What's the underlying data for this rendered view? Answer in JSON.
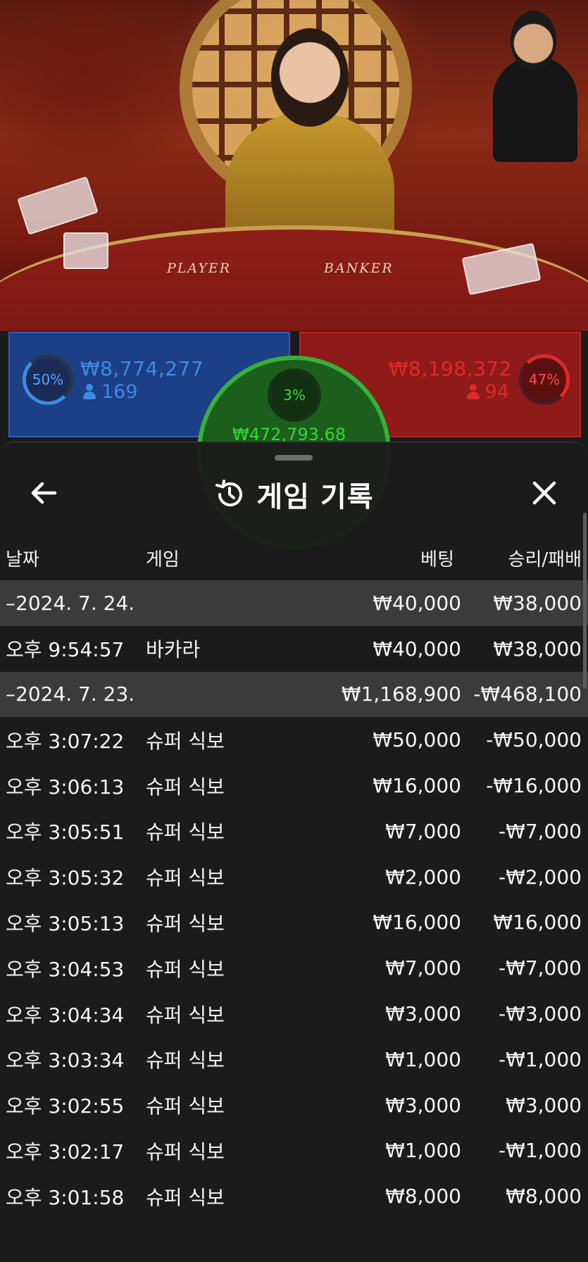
{
  "table": {
    "player_label": "PLAYER",
    "banker_label": "BANKER"
  },
  "bets": {
    "player": {
      "percent": "50%",
      "amount": "₩8,774,277",
      "count": "169",
      "color": "#3a8ce0"
    },
    "tie": {
      "percent": "3%",
      "amount": "₩472,793.68",
      "color": "#36d636"
    },
    "banker": {
      "percent": "47%",
      "amount": "₩8,198,372",
      "count": "94",
      "color": "#e02828"
    }
  },
  "sheet": {
    "title": "게임 기록",
    "back_icon": "arrow-left-icon",
    "history_icon": "history-icon",
    "close_icon": "close-icon",
    "columns": {
      "date": "날짜",
      "game": "게임",
      "bet": "베팅",
      "result": "승리/패배"
    },
    "rows": [
      {
        "type": "date",
        "date": "–2024. 7. 24.",
        "game": "",
        "bet": "₩40,000",
        "result": "₩38,000"
      },
      {
        "type": "entry",
        "date": "오후 9:54:57",
        "game": "바카라",
        "bet": "₩40,000",
        "result": "₩38,000"
      },
      {
        "type": "date",
        "date": "–2024. 7. 23.",
        "game": "",
        "bet": "₩1,168,900",
        "result": "-₩468,100"
      },
      {
        "type": "entry",
        "date": "오후 3:07:22",
        "game": "슈퍼 식보",
        "bet": "₩50,000",
        "result": "-₩50,000"
      },
      {
        "type": "entry",
        "date": "오후 3:06:13",
        "game": "슈퍼 식보",
        "bet": "₩16,000",
        "result": "-₩16,000"
      },
      {
        "type": "entry",
        "date": "오후 3:05:51",
        "game": "슈퍼 식보",
        "bet": "₩7,000",
        "result": "-₩7,000"
      },
      {
        "type": "entry",
        "date": "오후 3:05:32",
        "game": "슈퍼 식보",
        "bet": "₩2,000",
        "result": "-₩2,000"
      },
      {
        "type": "entry",
        "date": "오후 3:05:13",
        "game": "슈퍼 식보",
        "bet": "₩16,000",
        "result": "₩16,000"
      },
      {
        "type": "entry",
        "date": "오후 3:04:53",
        "game": "슈퍼 식보",
        "bet": "₩7,000",
        "result": "-₩7,000"
      },
      {
        "type": "entry",
        "date": "오후 3:04:34",
        "game": "슈퍼 식보",
        "bet": "₩3,000",
        "result": "-₩3,000"
      },
      {
        "type": "entry",
        "date": "오후 3:03:34",
        "game": "슈퍼 식보",
        "bet": "₩1,000",
        "result": "-₩1,000"
      },
      {
        "type": "entry",
        "date": "오후 3:02:55",
        "game": "슈퍼 식보",
        "bet": "₩3,000",
        "result": "₩3,000"
      },
      {
        "type": "entry",
        "date": "오후 3:02:17",
        "game": "슈퍼 식보",
        "bet": "₩1,000",
        "result": "-₩1,000"
      },
      {
        "type": "entry",
        "date": "오후 3:01:58",
        "game": "슈퍼 식보",
        "bet": "₩8,000",
        "result": "₩8,000"
      }
    ]
  }
}
